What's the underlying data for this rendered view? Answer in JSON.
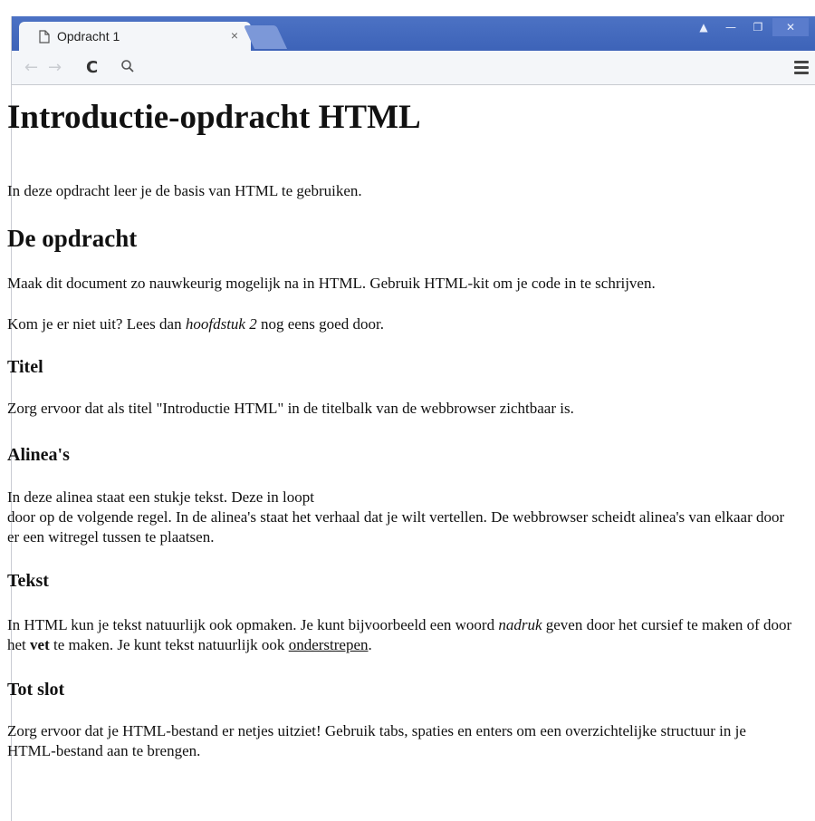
{
  "browser": {
    "tab_title": "Opdracht 1",
    "tab_close": "×",
    "window_buttons": [
      "▲",
      "—",
      "❐",
      "✕"
    ],
    "nav": {
      "back": "←",
      "forward": "→",
      "reload": "C"
    }
  },
  "page": {
    "h1": "Introductie-opdracht HTML",
    "intro": "In deze opdracht leer je de basis van HTML te gebruiken.",
    "h2": "De opdracht",
    "p1": "Maak dit document zo nauwkeurig mogelijk na in HTML. Gebruik HTML-kit om je code in te schrijven.",
    "p2_before": "Kom je er niet uit? Lees dan ",
    "p2_italic": "hoofdstuk 2",
    "p2_after": " nog eens goed door.",
    "titel_heading": "Titel",
    "titel_text": "Zorg ervoor dat als titel \"Introductie HTML\" in de titelbalk van de webbrowser zichtbaar is.",
    "alinea_heading": "Alinea's",
    "alinea_line1": "In deze alinea staat een stukje tekst. Deze in loopt",
    "alinea_line2": "door op de volgende regel. In de alinea's staat het verhaal dat je wilt vertellen. De webbrowser scheidt alinea's van elkaar door er een witregel tussen te plaatsen.",
    "tekst_heading": "Tekst",
    "tekst_before": "In HTML kun je tekst natuurlijk ook opmaken. Je kunt bijvoorbeeld een woord ",
    "tekst_italic": "nadruk",
    "tekst_mid": " geven door het cursief te maken of door het ",
    "tekst_bold": "vet",
    "tekst_mid2": " te maken. Je kunt tekst natuurlijk ook ",
    "tekst_underline": "onderstrepen",
    "tekst_end": ".",
    "slot_heading": "Tot slot",
    "slot_text": "Zorg ervoor dat je HTML-bestand er netjes uitziet! Gebruik tabs, spaties en enters om een overzichtelijke structuur in je HTML-bestand aan te brengen."
  },
  "icons": {
    "tab": "document-icon",
    "search": "search-icon",
    "menu": "hamburger-menu-icon"
  },
  "colors": {
    "titlebar": "#4c72c4",
    "toolbar": "#f4f6f9",
    "text": "#111111"
  }
}
